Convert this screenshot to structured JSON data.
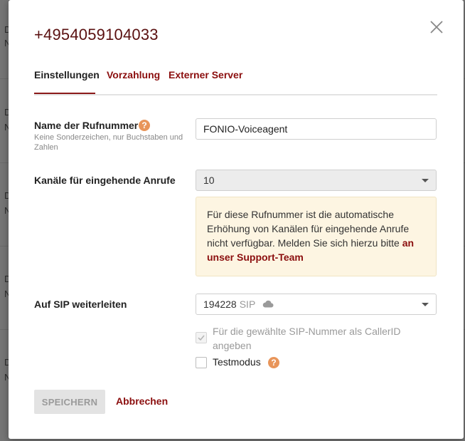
{
  "modal": {
    "title": "+4954059104033",
    "close_icon": "close-icon"
  },
  "tabs": [
    {
      "label": "Einstellungen",
      "active": true
    },
    {
      "label": "Vorzahlung",
      "active": false
    },
    {
      "label": "Externer Server",
      "active": false
    }
  ],
  "fields": {
    "name": {
      "label": "Name der Rufnummer",
      "hint": "Keine Sonderzeichen, nur Buchstaben und Zahlen",
      "value": "FONIO-Voiceagent",
      "help_icon": "question-icon"
    },
    "channels": {
      "label": "Kanäle für eingehende Anrufe",
      "value": "10"
    },
    "notice": {
      "text": "Für diese Rufnummer ist die automatische Erhöhung von Kanälen für eingehende Anrufe nicht verfügbar. Melden Sie sich hierzu bitte ",
      "link": "an unser Support-Team"
    },
    "sip": {
      "label": "Auf SIP weiterleiten",
      "number": "194228",
      "tag": "SIP",
      "icon": "cloud-icon"
    },
    "callerid_checkbox": {
      "label": "Für die gewählte SIP-Nummer als CallerID angeben",
      "checked": true,
      "disabled": true
    },
    "testmode_checkbox": {
      "label": "Testmodus",
      "checked": false
    }
  },
  "actions": {
    "save_label": "SPEICHERN",
    "cancel_label": "Abbrechen"
  },
  "background": {
    "row_letters": [
      "D",
      "N",
      "D",
      "N",
      "D",
      "N",
      "D",
      "N",
      "D",
      "N"
    ]
  },
  "colors": {
    "accent": "#8b0e0e",
    "title": "#5a1010",
    "help": "#e8955a",
    "notice_bg": "#fdf5e2"
  }
}
